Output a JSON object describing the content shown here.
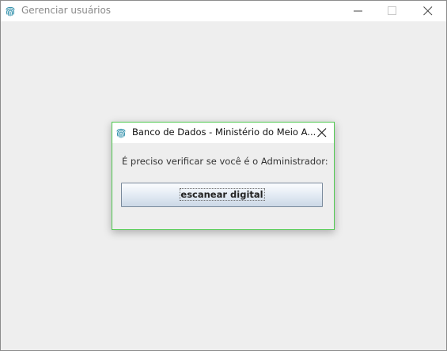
{
  "main_window": {
    "title": "Gerenciar usuários",
    "icon": "fingerprint-icon",
    "controls": [
      "minimize-icon",
      "maximize-icon",
      "close-icon"
    ]
  },
  "dialog": {
    "title": "Banco de Dados - Ministério do Meio A...",
    "icon": "fingerprint-icon",
    "message": "É preciso verificar se você é o Administrador:",
    "button_label": "escanear digital",
    "close_icon": "close-icon"
  },
  "colors": {
    "dialog_border": "#4fc94f",
    "icon_accent": "#2a8ca8",
    "background": "#eeeeee"
  }
}
